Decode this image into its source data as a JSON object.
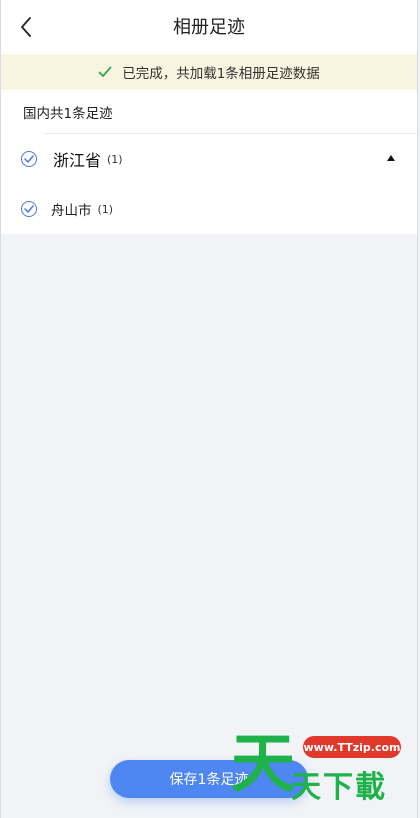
{
  "header": {
    "title": "相册足迹",
    "back_icon": "chevron-left-icon"
  },
  "notice": {
    "text": "已完成，共加载1条相册足迹数据",
    "icon": "check-icon",
    "color": "#2eaa4a"
  },
  "summary": {
    "text": "国内共1条足迹"
  },
  "list": {
    "province": {
      "name": "浙江省",
      "count": "(1)",
      "checked": true,
      "expanded": true
    },
    "city": {
      "name": "舟山市",
      "count": "(1)",
      "checked": true
    }
  },
  "footer": {
    "save_label": "保存1条足迹"
  },
  "watermark": {
    "url": "www.TTzip.com",
    "big_char": "天",
    "text": "天下載"
  },
  "colors": {
    "accent": "#4e86f2",
    "check_border": "#4a78d8",
    "notice_bg": "#f8f4df",
    "page_bg": "#f2f3f7",
    "watermark_green": "#1fb24a",
    "watermark_red": "#e0392c"
  }
}
